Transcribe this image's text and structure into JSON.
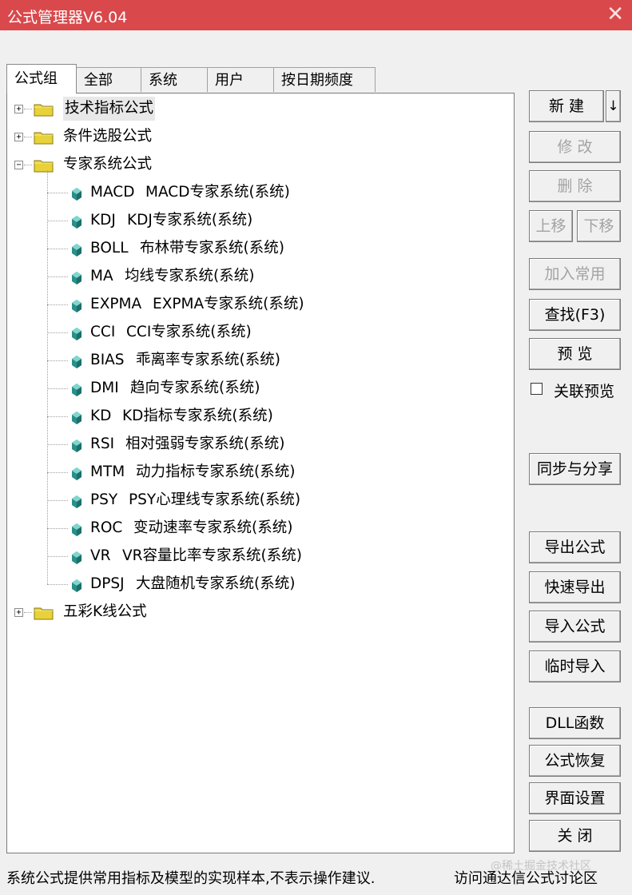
{
  "window": {
    "title": "公式管理器V6.04"
  },
  "tabs": [
    {
      "label": "公式组"
    },
    {
      "label": "全部"
    },
    {
      "label": "系统"
    },
    {
      "label": "用户"
    },
    {
      "label": "按日期频度"
    }
  ],
  "tree": {
    "folders_top": [
      {
        "label": "技术指标公式",
        "expander": "+"
      },
      {
        "label": "条件选股公式",
        "expander": "+"
      },
      {
        "label": "专家系统公式",
        "expander": "−"
      }
    ],
    "expert_items": [
      {
        "code": "MACD",
        "name": "MACD专家系统(系统)"
      },
      {
        "code": "KDJ",
        "name": "KDJ专家系统(系统)"
      },
      {
        "code": "BOLL",
        "name": "布林带专家系统(系统)"
      },
      {
        "code": "MA",
        "name": "均线专家系统(系统)"
      },
      {
        "code": "EXPMA",
        "name": "EXPMA专家系统(系统)"
      },
      {
        "code": "CCI",
        "name": "CCI专家系统(系统)"
      },
      {
        "code": "BIAS",
        "name": "乖离率专家系统(系统)"
      },
      {
        "code": "DMI",
        "name": "趋向专家系统(系统)"
      },
      {
        "code": "KD",
        "name": "KD指标专家系统(系统)"
      },
      {
        "code": "RSI",
        "name": "相对强弱专家系统(系统)"
      },
      {
        "code": "MTM",
        "name": "动力指标专家系统(系统)"
      },
      {
        "code": "PSY",
        "name": "PSY心理线专家系统(系统)"
      },
      {
        "code": "ROC",
        "name": "变动速率专家系统(系统)"
      },
      {
        "code": "VR",
        "name": "VR容量比率专家系统(系统)"
      },
      {
        "code": "DPSJ",
        "name": "大盘随机专家系统(系统)"
      }
    ],
    "folders_bottom": [
      {
        "label": "五彩K线公式",
        "expander": "+"
      }
    ]
  },
  "buttons": {
    "new": "新 建",
    "new_arrow": "↓",
    "modify": "修 改",
    "delete": "删 除",
    "move_up": "上移",
    "move_down": "下移",
    "add_common": "加入常用",
    "find": "查找(F3)",
    "preview": "预 览",
    "sync_share": "同步与分享",
    "export": "导出公式",
    "quick_export": "快速导出",
    "import": "导入公式",
    "temp_import": "临时导入",
    "dll": "DLL函数",
    "restore": "公式恢复",
    "ui_settings": "界面设置",
    "close": "关 闭"
  },
  "link_preview": {
    "label": "关联预览",
    "checked": false
  },
  "status": {
    "note": "系统公式提供常用指标及模型的实现样本,不表示操作建议.",
    "forum_link": "访问通达信公式讨论区"
  },
  "watermark": "@稀土掘金技术社区",
  "colors": {
    "titlebar": "#d9494c",
    "leaf_icon": "#2a8f8a",
    "folder": "#e8d23a"
  }
}
